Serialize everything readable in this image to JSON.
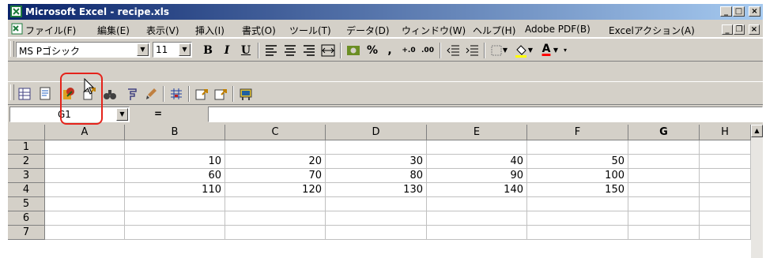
{
  "window": {
    "title": "Microsoft Excel - recipe.xls",
    "buttons": {
      "minimize": "_",
      "maximize": "□",
      "close": "×"
    }
  },
  "menubar": {
    "items": [
      "ファイル(F)",
      "編集(E)",
      "表示(V)",
      "挿入(I)",
      "書式(O)",
      "ツール(T)",
      "データ(D)",
      "ウィンドウ(W)",
      "ヘルプ(H)",
      "Adobe PDF(B)",
      "Excelアクション(A)"
    ],
    "doc_buttons": {
      "minimize": "_",
      "restore": "❐",
      "close": "×"
    }
  },
  "format_toolbar": {
    "font_name": "MS Pゴシック",
    "font_size": "11",
    "bold": "B",
    "italic": "I",
    "underline": "U",
    "percent": "%",
    "comma": ",",
    "inc_decimal": "+.0",
    "dec_decimal": ".00",
    "font_color_label": "A"
  },
  "addin_toolbar": {
    "icons": [
      "table-icon",
      "sheet-icon",
      "recipe-icon",
      "upload-icon",
      "binoculars-icon",
      "formula-icon",
      "brush-icon",
      "grid-icon",
      "export-icon",
      "export2-icon",
      "device-icon"
    ]
  },
  "formula_bar": {
    "name_box": "G1",
    "equals": "=",
    "formula": ""
  },
  "grid": {
    "columns": [
      "A",
      "B",
      "C",
      "D",
      "E",
      "F",
      "G",
      "H"
    ],
    "active_column": "G",
    "rows": [
      "1",
      "2",
      "3",
      "4",
      "5",
      "6",
      "7"
    ],
    "cells": [
      [
        "",
        "",
        "",
        "",
        "",
        "",
        "",
        ""
      ],
      [
        "",
        "10",
        "20",
        "30",
        "40",
        "50",
        "",
        ""
      ],
      [
        "",
        "60",
        "70",
        "80",
        "90",
        "100",
        "",
        ""
      ],
      [
        "",
        "110",
        "120",
        "130",
        "140",
        "150",
        "",
        ""
      ],
      [
        "",
        "",
        "",
        "",
        "",
        "",
        "",
        ""
      ],
      [
        "",
        "",
        "",
        "",
        "",
        "",
        "",
        ""
      ],
      [
        "",
        "",
        "",
        "",
        "",
        "",
        "",
        ""
      ]
    ]
  },
  "colors": {
    "title_start": "#0a246a",
    "title_end": "#a6caf0",
    "highlight": "#e5231b",
    "chrome": "#d4d0c8"
  }
}
